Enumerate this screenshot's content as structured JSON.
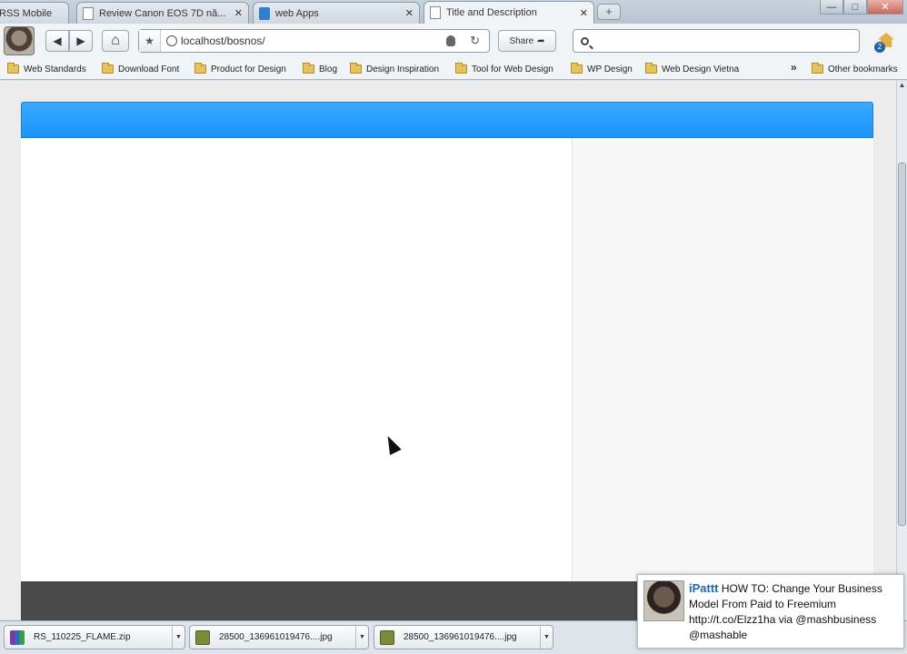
{
  "tabs": [
    {
      "label": "RSS Mobile",
      "icon": "page-icon",
      "active": false
    },
    {
      "label": "Review Canon EOS 7D nă...",
      "icon": "page-icon",
      "active": false
    },
    {
      "label": "web Apps",
      "icon": "save-icon",
      "active": false
    },
    {
      "label": "Title and Description",
      "icon": "page-icon",
      "active": true
    }
  ],
  "new_tab": "+",
  "window_controls": {
    "minimize": "—",
    "maximize": "□",
    "close": "✕"
  },
  "toolbar": {
    "back": "◀",
    "forward": "▶",
    "home": "⌂",
    "star": "★",
    "url": "localhost/bosnos/",
    "reload": "↻",
    "share_label": "Share",
    "search_placeholder": "",
    "extension_badge": "2"
  },
  "bookmarks": [
    "Web Standards",
    "Download Font",
    "Product for Design",
    "Blog",
    "Design Inspiration",
    "Tool for Web Design",
    "WP Design",
    "Web Design Vietna"
  ],
  "bookmarks_overflow": "»",
  "other_bookmarks": "Other bookmarks",
  "page": {
    "header_color": "#2aa0ff",
    "footer_color": "#4a4a4a"
  },
  "downloads": [
    {
      "name": "RS_110225_FLAME.zip",
      "icon": "rar-icon"
    },
    {
      "name": "28500_136961019476....jpg",
      "icon": "image-icon"
    },
    {
      "name": "28500_136961019476....jpg",
      "icon": "image-icon"
    }
  ],
  "notification": {
    "user": "iPattt",
    "text": "HOW TO: Change Your Business Model From Paid to Freemium http://t.co/Elzz1ha via @mashbusiness",
    "source": "@mashable"
  }
}
